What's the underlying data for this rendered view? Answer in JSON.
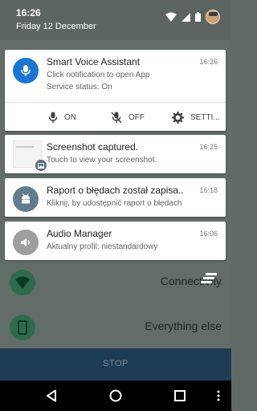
{
  "status_bar": {
    "time": "16:26",
    "date": "Friday 12 December",
    "icons": [
      "wifi-icon",
      "signal-icon",
      "battery-icon",
      "avatar"
    ]
  },
  "notifications": [
    {
      "app": "Smart Voice Assistant",
      "time": "16:26",
      "line1": "Click notification to open App",
      "line2": "Service status: On",
      "icon": "microphone-icon",
      "color": "#1976d2",
      "actions": [
        {
          "label": "ON",
          "icon": "microphone-icon"
        },
        {
          "label": "OFF",
          "icon": "microphone-off-icon"
        },
        {
          "label": "SETTI...",
          "icon": "gear-icon"
        }
      ]
    },
    {
      "app": "Screenshot captured.",
      "time": "16:25",
      "line1": "Touch to view your screenshot.",
      "icon": "image-icon"
    },
    {
      "app": "Raport o błędach został zapisa..",
      "time": "16:18",
      "line1": "Kliknij, by udostępnić raport o błędach",
      "icon": "android-bug-icon",
      "color": "#607d8b"
    },
    {
      "app": "Audio Manager",
      "time": "16:06",
      "line1": "Aktualny profil: niestandardowy",
      "icon": "speaker-icon",
      "color": "#9e9e9e"
    }
  ],
  "background_app": {
    "items": [
      {
        "label": "Connectivity",
        "icon": "wifi-icon"
      },
      {
        "label": "Everything else",
        "icon": "phone-icon"
      }
    ],
    "stop_label": "STOP"
  },
  "nav": [
    "back-icon",
    "home-icon",
    "recents-icon",
    "more-icon"
  ]
}
